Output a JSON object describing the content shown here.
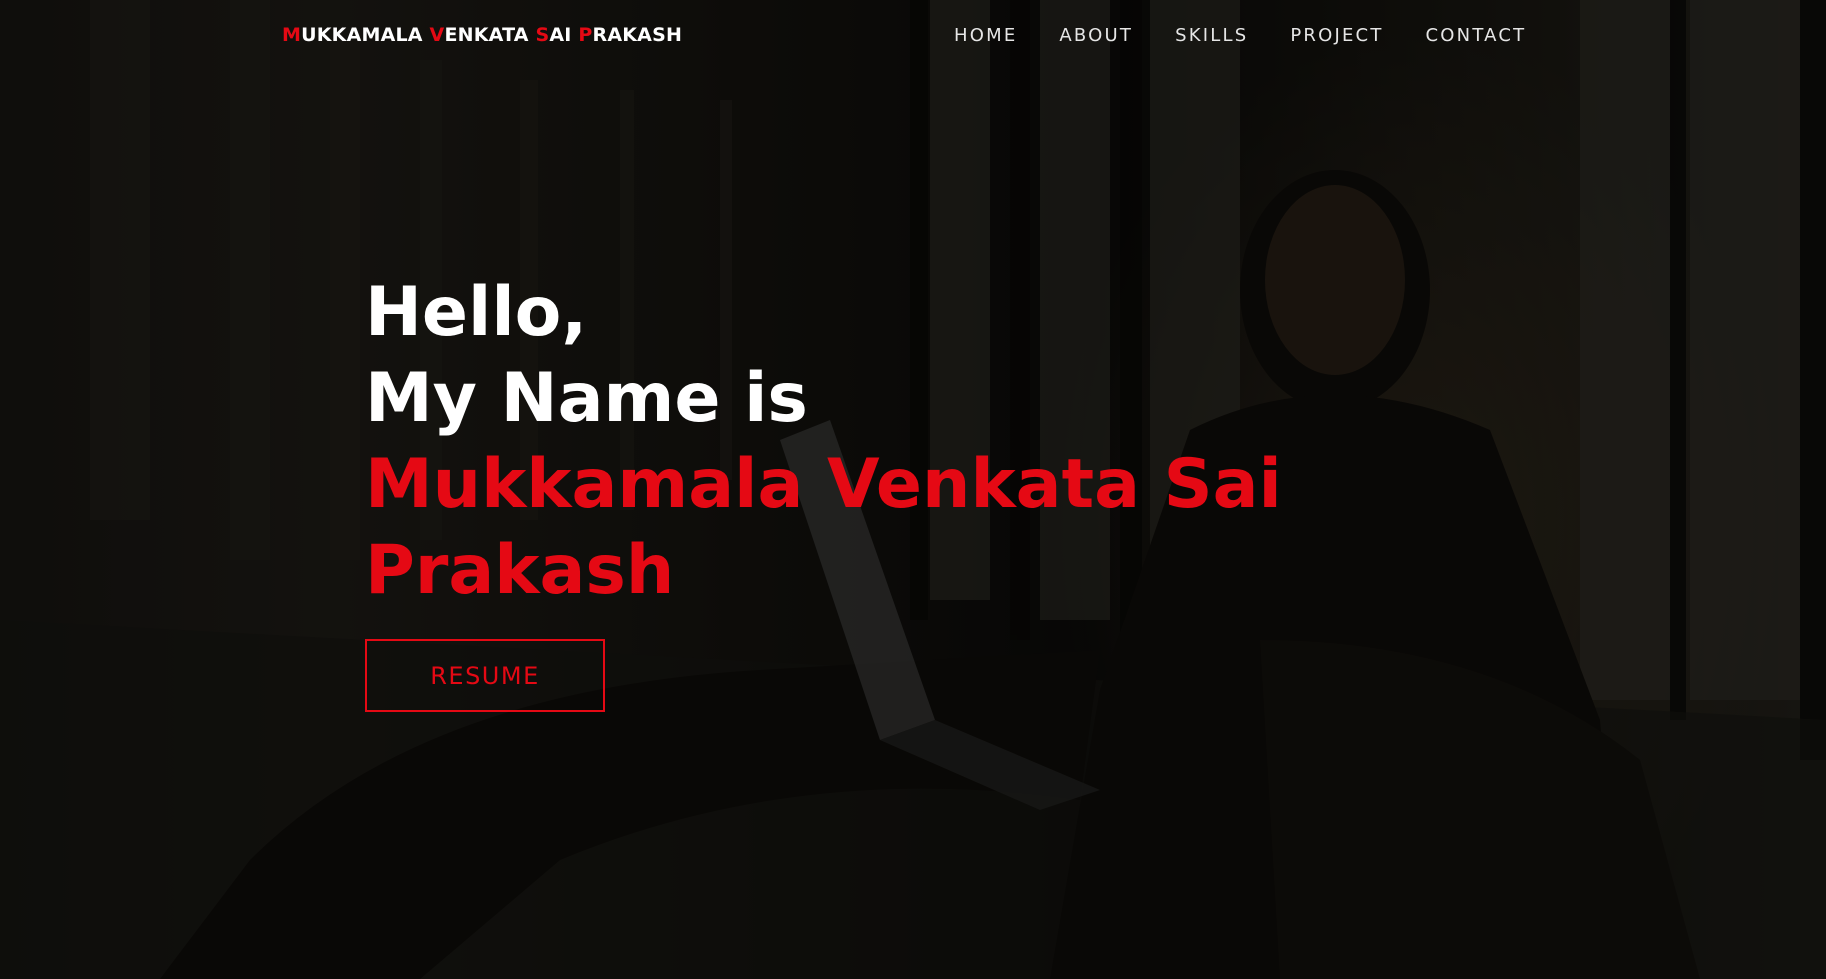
{
  "nav": {
    "brand_parts": [
      {
        "cap": "M",
        "rest": "UKKAMALA "
      },
      {
        "cap": "V",
        "rest": "ENKATA "
      },
      {
        "cap": "S",
        "rest": "AI "
      },
      {
        "cap": "P",
        "rest": "RAKASH"
      }
    ],
    "links": [
      "HOME",
      "ABOUT",
      "SKILLS",
      "PROJECT",
      "CONTACT"
    ]
  },
  "hero": {
    "greeting": "Hello,",
    "intro": "My Name is",
    "name": "Mukkamala Venkata Sai Prakash",
    "button_label": "RESUME"
  },
  "colors": {
    "accent": "#e50914",
    "text": "#ffffff",
    "overlay": "#000000"
  }
}
